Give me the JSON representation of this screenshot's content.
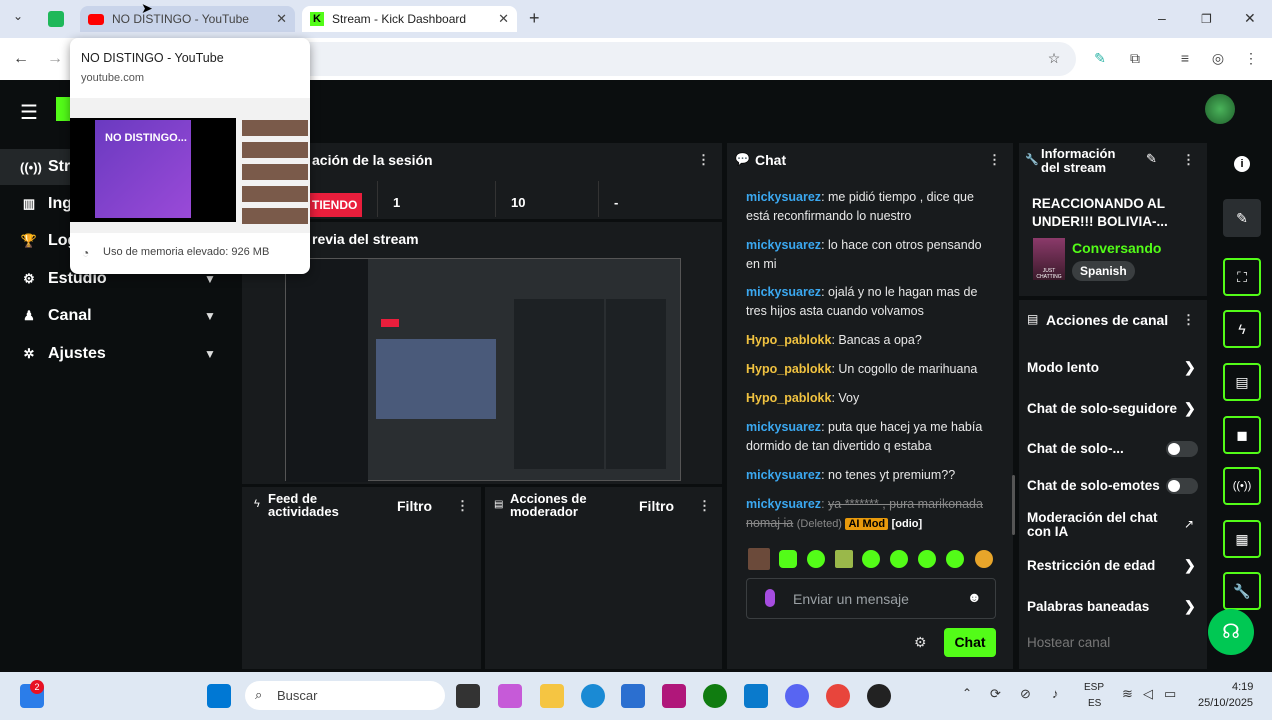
{
  "browser": {
    "tabs": [
      {
        "label": "NO DISTINGO - YouTube",
        "active": false
      },
      {
        "label": "Stream - Kick Dashboard",
        "active": true
      }
    ],
    "new_tab": "+",
    "min": "–",
    "restore": "❐",
    "close": "✕"
  },
  "tab_preview": {
    "title": "NO DISTINGO - YouTube",
    "domain": "youtube.com",
    "thumb_text": "NO DISTINGO...",
    "memory": "Uso de memoria elevado: 926 MB"
  },
  "sidebar": {
    "items": [
      {
        "label": "Stre",
        "icon": "broadcast-icon",
        "glyph": "((•))",
        "chevron": false
      },
      {
        "label": "Ingr",
        "icon": "chart-icon",
        "glyph": "▥",
        "chevron": false
      },
      {
        "label": "Log",
        "icon": "trophy-icon",
        "glyph": "🏆",
        "chevron": false
      },
      {
        "label": "Estudio",
        "icon": "studio-icon",
        "glyph": "⚙",
        "chevron": true
      },
      {
        "label": "Canal",
        "icon": "channel-icon",
        "glyph": "♟",
        "chevron": true
      },
      {
        "label": "Ajustes",
        "icon": "settings-icon",
        "glyph": "✲",
        "chevron": true
      }
    ]
  },
  "session": {
    "title": "ación de la sesión",
    "live_badge": "TIENDO",
    "stats": [
      "1",
      "10",
      "-"
    ],
    "preview_title": "revia del stream"
  },
  "activity_feed": {
    "title": "Feed de actividades",
    "filter": "Filtro"
  },
  "mod_actions": {
    "title": "Acciones de moderador",
    "filter": "Filtro"
  },
  "chat": {
    "title": "Chat",
    "messages": [
      {
        "user": "mickysuarez",
        "text": "me pidió tiempo , dice que está reconfirmando lo nuestro",
        "color": "#3ba8f0"
      },
      {
        "user": "mickysuarez",
        "text": "lo hace con otros pensando en mi",
        "color": "#3ba8f0"
      },
      {
        "user": "mickysuarez",
        "text": "ojalá y no le hagan mas de tres hijos asta cuando volvamos",
        "color": "#3ba8f0"
      },
      {
        "user": "Hypo_pablokk",
        "text": "Bancas a opa?",
        "color": "#f0c240"
      },
      {
        "user": "Hypo_pablokk",
        "text": "Un cogollo de marihuana",
        "color": "#f0c240"
      },
      {
        "user": "Hypo_pablokk",
        "text": "Voy",
        "color": "#f0c240"
      },
      {
        "user": "mickysuarez",
        "text": "puta que hacej ya me había dormido de tan divertido q estaba",
        "color": "#3ba8f0"
      },
      {
        "user": "mickysuarez",
        "text": "no tenes yt premium??",
        "color": "#3ba8f0"
      }
    ],
    "deleted": {
      "user": "mickysuarez",
      "text": "ya ******* , pura marikonada nomaj ia",
      "deleted_label": "(Deleted)",
      "ai_badge": "AI Mod",
      "reason": "[odio]"
    },
    "input_placeholder": "Enviar un mensaje",
    "send_label": "Chat"
  },
  "stream_info": {
    "title": "Información del stream",
    "stream_title": "REACCIONANDO AL UNDER!!! BOLIVIA-...",
    "category": "Conversando",
    "language": "Spanish",
    "thumb_text": "JUST CHATTING"
  },
  "channel_actions": {
    "title": "Acciones de canal",
    "items": [
      {
        "label": "Modo lento",
        "control": "arrow"
      },
      {
        "label": "Chat de solo-seguidores",
        "control": "arrow"
      },
      {
        "label": "Chat de solo-...",
        "control": "toggle"
      },
      {
        "label": "Chat de solo-emotes",
        "control": "toggle"
      },
      {
        "label": "Moderación del chat con IA",
        "control": "external"
      },
      {
        "label": "Restricción de edad",
        "control": "arrow"
      },
      {
        "label": "Palabras baneadas",
        "control": "arrow"
      }
    ],
    "host": "Hostear canal"
  },
  "taskbar": {
    "search_placeholder": "Buscar",
    "badge": "2",
    "lang_top": "ESP",
    "lang_bottom": "ES",
    "time": "4:19",
    "date": "25/10/2025"
  },
  "colors": {
    "kick_green": "#53fc18",
    "live_red": "#e91e3c"
  }
}
